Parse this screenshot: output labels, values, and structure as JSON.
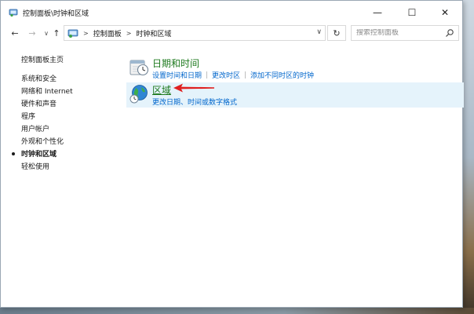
{
  "window": {
    "title": "控制面板\\时钟和区域"
  },
  "titlebar": {
    "minimize_glyph": "—",
    "maximize_glyph": "☐",
    "close_glyph": "✕"
  },
  "nav": {
    "back_glyph": "←",
    "forward_glyph": "→",
    "recent_glyph": "∨",
    "up_glyph": "↑",
    "breadcrumb": [
      "控制面板",
      "时钟和区域"
    ],
    "crumb_sep": ">",
    "refresh_glyph": "↻",
    "dropdown_glyph": "∨"
  },
  "search": {
    "placeholder": "搜索控制面板"
  },
  "sidebar": {
    "items": [
      {
        "label": "控制面板主页"
      },
      {
        "label": "系统和安全"
      },
      {
        "label": "网络和 Internet"
      },
      {
        "label": "硬件和声音"
      },
      {
        "label": "程序"
      },
      {
        "label": "用户帐户"
      },
      {
        "label": "外观和个性化"
      },
      {
        "label": "时钟和区域"
      },
      {
        "label": "轻松使用"
      }
    ]
  },
  "categories": [
    {
      "title": "日期和时间",
      "icon": "clock-calendar-icon",
      "links": [
        "设置时间和日期",
        "更改时区",
        "添加不同时区的时钟"
      ]
    },
    {
      "title": "区域",
      "icon": "globe-clock-icon",
      "links": [
        "更改日期、时间或数字格式"
      ]
    }
  ],
  "colors": {
    "link": "#0066cc",
    "category_title": "#1e7a1e",
    "selection": "#e5f3fb",
    "annotation_arrow": "#e02020"
  }
}
